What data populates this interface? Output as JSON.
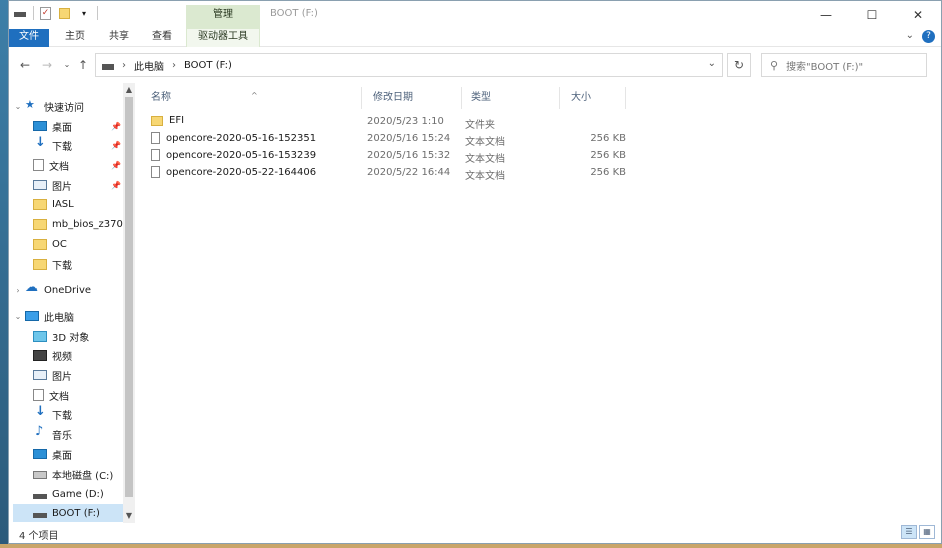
{
  "window": {
    "title": "BOOT (F:)",
    "context_tab_group": "管理",
    "controls": [
      "—",
      "☐",
      "✕"
    ]
  },
  "ribbon": {
    "tabs": [
      "文件",
      "主页",
      "共享",
      "查看",
      "驱动器工具"
    ],
    "help": "?"
  },
  "address": {
    "segments": [
      "此电脑",
      "BOOT (F:)"
    ],
    "search_placeholder": "搜索\"BOOT (F:)\""
  },
  "nav": {
    "quick_access": "快速访问",
    "quick_items": [
      {
        "label": "桌面",
        "icon": "desktop-icon",
        "pinned": true
      },
      {
        "label": "下载",
        "icon": "download-icon",
        "pinned": true
      },
      {
        "label": "文档",
        "icon": "document-icon",
        "pinned": true
      },
      {
        "label": "图片",
        "icon": "picture-icon",
        "pinned": true
      },
      {
        "label": "IASL",
        "icon": "folder-icon",
        "pinned": false
      },
      {
        "label": "mb_bios_z370-",
        "icon": "folder-icon",
        "pinned": false
      },
      {
        "label": "OC",
        "icon": "folder-icon",
        "pinned": false
      },
      {
        "label": "下载",
        "icon": "folder-icon",
        "pinned": false
      }
    ],
    "onedrive": "OneDrive",
    "this_pc": "此电脑",
    "pc_items": [
      {
        "label": "3D 对象",
        "icon": "3d-objects-icon"
      },
      {
        "label": "视频",
        "icon": "video-icon"
      },
      {
        "label": "图片",
        "icon": "picture-icon"
      },
      {
        "label": "文档",
        "icon": "document-icon"
      },
      {
        "label": "下载",
        "icon": "download-icon"
      },
      {
        "label": "音乐",
        "icon": "music-icon"
      },
      {
        "label": "桌面",
        "icon": "desktop-icon"
      },
      {
        "label": "本地磁盘 (C:)",
        "icon": "hard-disk-icon"
      },
      {
        "label": "Game (D:)",
        "icon": "drive-icon"
      },
      {
        "label": "BOOT (F:)",
        "icon": "drive-icon",
        "selected": true
      }
    ]
  },
  "columns": {
    "name": "名称",
    "date": "修改日期",
    "type": "类型",
    "size": "大小"
  },
  "files": [
    {
      "name": "EFI",
      "date": "2020/5/23 1:10",
      "type": "文件夹",
      "size": "",
      "kind": "folder"
    },
    {
      "name": "opencore-2020-05-16-152351",
      "date": "2020/5/16 15:24",
      "type": "文本文档",
      "size": "256 KB",
      "kind": "doc"
    },
    {
      "name": "opencore-2020-05-16-153239",
      "date": "2020/5/16 15:32",
      "type": "文本文档",
      "size": "256 KB",
      "kind": "doc"
    },
    {
      "name": "opencore-2020-05-22-164406",
      "date": "2020/5/22 16:44",
      "type": "文本文档",
      "size": "256 KB",
      "kind": "doc"
    }
  ],
  "status": {
    "item_count": "4 个项目"
  }
}
